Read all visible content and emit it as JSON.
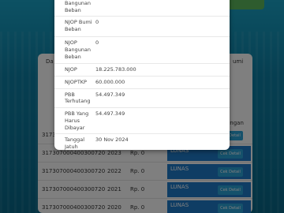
{
  "background": {
    "table_headers": [
      "Da",
      "umi",
      "angan"
    ],
    "rows": [
      {
        "nop": "317307000400300720",
        "year": "",
        "amount": "",
        "status": "",
        "detail": "Cek Detail"
      },
      {
        "nop": "317307000400300720",
        "year": "2023",
        "amount": "Rp. 0",
        "status": "LUNAS",
        "detail": "Cek Detail"
      },
      {
        "nop": "317307000400300720",
        "year": "2022",
        "amount": "Rp. 0",
        "status": "LUNAS",
        "detail": "Cek Detail"
      },
      {
        "nop": "317307000400300720",
        "year": "2021",
        "amount": "Rp. 0",
        "status": "LUNAS",
        "detail": "Cek Detail"
      },
      {
        "nop": "317307000400300720",
        "year": "2020",
        "amount": "Rp. 0",
        "status": "LUNAS",
        "detail": "Cek Detail"
      }
    ]
  },
  "modal": {
    "fields": [
      {
        "label": "Luas Bangunan Beban",
        "value": "0"
      },
      {
        "label": "NJOP Bumi Beban",
        "value": "0"
      },
      {
        "label": "NJOP Bangunan Beban",
        "value": "0"
      },
      {
        "label": "NJOP",
        "value": "18.225.783.000"
      },
      {
        "label": "NJOPTKP",
        "value": "60.000.000"
      },
      {
        "label": "PBB Terhutang",
        "value": "54.497.349"
      },
      {
        "label": "PBB Yang Harus Dibayar",
        "value": "54.497.349"
      },
      {
        "label": "Tanggal Jatuh Tempo",
        "value": "30 Nov 2024"
      }
    ]
  }
}
